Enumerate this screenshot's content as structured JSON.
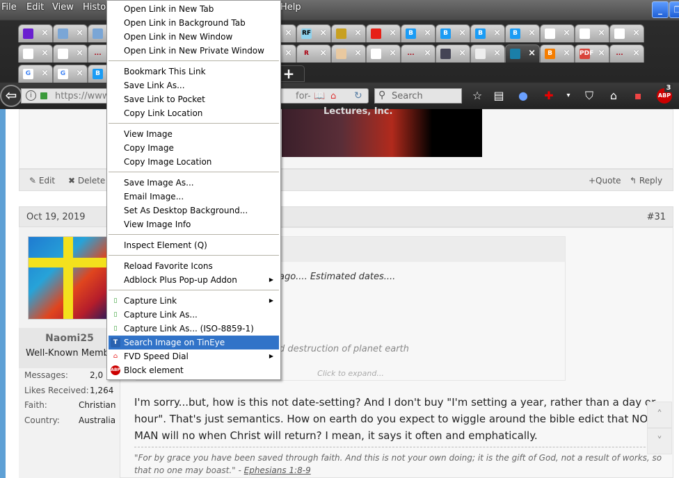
{
  "menubar": {
    "items": [
      "File",
      "Edit",
      "View",
      "Histor",
      "Help"
    ]
  },
  "tabs": {
    "row1": [
      {
        "icon": "mail-icon",
        "color": "#6a1fd0"
      },
      {
        "icon": "bible-icon",
        "color": "#7aa6d6"
      },
      {
        "icon": "bible-icon",
        "color": "#7aa6d6"
      },
      {
        "icon": "tab-icon",
        "color": "#888"
      },
      {
        "icon": "tab-icon",
        "color": "#888"
      },
      {
        "icon": "tab-icon",
        "color": "#888"
      },
      {
        "icon": "tab-icon",
        "color": "#888"
      },
      {
        "icon": "tab-icon",
        "color": "#888"
      },
      {
        "icon": "rf-icon",
        "color": "#8fd3ee",
        "text": "RF"
      },
      {
        "icon": "emblem-icon",
        "color": "#c8a020"
      },
      {
        "icon": "youtube-icon",
        "color": "#e62117"
      },
      {
        "icon": "b-icon",
        "color": "#1a9cf5",
        "text": "B"
      },
      {
        "icon": "b-icon",
        "color": "#1a9cf5",
        "text": "B"
      },
      {
        "icon": "b-icon",
        "color": "#1a9cf5",
        "text": "B"
      },
      {
        "icon": "b-icon",
        "color": "#1a9cf5",
        "text": "B"
      },
      {
        "icon": "sparkle-icon",
        "color": "#fff"
      },
      {
        "icon": "sparkle-icon",
        "color": "#fff"
      },
      {
        "icon": "sparkle-icon",
        "color": "#fff"
      }
    ],
    "row2": [
      {
        "icon": "sparkle-icon",
        "color": "#fff"
      },
      {
        "icon": "sparkle-icon",
        "color": "#fff"
      },
      {
        "icon": "dots-icon",
        "color": "transparent",
        "text": "..."
      },
      {
        "icon": "tab-icon",
        "color": "#888"
      },
      {
        "icon": "tab-icon",
        "color": "#888"
      },
      {
        "icon": "tab-icon",
        "color": "#888"
      },
      {
        "icon": "tab-icon",
        "color": "#888"
      },
      {
        "icon": "tab-icon",
        "color": "#888"
      },
      {
        "icon": "r-icon",
        "color": "transparent",
        "text": "R"
      },
      {
        "icon": "portrait-icon",
        "color": "#e9c9a0"
      },
      {
        "icon": "car-icon",
        "color": "#fff"
      },
      {
        "icon": "dots-icon",
        "color": "transparent",
        "text": "..."
      },
      {
        "icon": "book-icon",
        "color": "#445"
      },
      {
        "icon": "page-icon",
        "color": "#eee"
      },
      {
        "icon": "menorah-icon",
        "color": "#1b7fa8",
        "active": true
      },
      {
        "icon": "blogger-icon",
        "color": "#f57d00",
        "text": "B"
      },
      {
        "icon": "pdf-icon",
        "color": "#d9443a",
        "text": "PDF"
      },
      {
        "icon": "dots-icon",
        "color": "transparent",
        "text": "..."
      }
    ],
    "row3": [
      {
        "icon": "google-icon",
        "color": "#fff",
        "text": "G"
      },
      {
        "icon": "google-icon",
        "color": "#fff",
        "text": "G"
      },
      {
        "icon": "b-icon",
        "color": "#1a9cf5",
        "text": "B"
      }
    ],
    "close": "×",
    "new_tab": "+"
  },
  "navbar": {
    "url_start": "https://www",
    "url_end": "for-",
    "search_placeholder": "Search",
    "abp_badge": "3"
  },
  "context_menu": [
    {
      "label": "Open Link in New Tab"
    },
    {
      "label": "Open Link in Background Tab"
    },
    {
      "label": "Open Link in New Window"
    },
    {
      "label": "Open Link in New Private Window"
    },
    {
      "sep": true
    },
    {
      "label": "Bookmark This Link"
    },
    {
      "label": "Save Link As..."
    },
    {
      "label": "Save Link to Pocket"
    },
    {
      "label": "Copy Link Location"
    },
    {
      "sep": true
    },
    {
      "label": "View Image"
    },
    {
      "label": "Copy Image"
    },
    {
      "label": "Copy Image Location"
    },
    {
      "sep": true
    },
    {
      "label": "Save Image As..."
    },
    {
      "label": "Email Image..."
    },
    {
      "label": "Set As Desktop Background..."
    },
    {
      "label": "View Image Info"
    },
    {
      "sep": true
    },
    {
      "label": "Inspect Element (Q)"
    },
    {
      "sep": true
    },
    {
      "label": "Reload Favorite Icons"
    },
    {
      "label": "Adblock Plus Pop-up Addon",
      "submenu": true
    },
    {
      "sep": true
    },
    {
      "label": "Capture Link",
      "icon": "capture-icon",
      "submenu": true
    },
    {
      "label": "Capture Link As...",
      "icon": "capture-icon"
    },
    {
      "label": "Capture Link As... (ISO-8859-1)",
      "icon": "capture-icon"
    },
    {
      "label": "Search Image on TinEye",
      "icon": "tineye-icon",
      "highlighted": true
    },
    {
      "label": "FVD Speed Dial",
      "icon": "speed-dial-icon",
      "submenu": true
    },
    {
      "label": "Block element",
      "icon": "abp-icon"
    }
  ],
  "post_prev": {
    "image_caption": "Lectures, Inc.",
    "edit": "Edit",
    "delete": "Delete",
    "quote": "+Quote",
    "reply": "Reply"
  },
  "post": {
    "date": "Oct 19, 2019",
    "number": "#31",
    "user": {
      "name": "Naomi25",
      "title": "Well-Known Member",
      "stats": [
        {
          "label": "Messages:",
          "value": "2,0"
        },
        {
          "label": "Likes Received:",
          "value": "1,264"
        },
        {
          "label": "Faith:",
          "value": "Christian"
        },
        {
          "label": "Country:",
          "value": "Australia"
        }
      ]
    },
    "quote": {
      "line1": "ago.... Estimated dates....",
      "line2": "d destruction of planet earth",
      "expand": "Click to expand..."
    },
    "message": "I'm sorry...but, how is this not date-setting? And I don't buy \"I'm setting a year, rather than a day or hour\". That's just semantics. How on earth do you expect to wiggle around the bible edict that NO MAN will no when Christ will return? I mean, it says it often and emphatically.",
    "signature": "\"For by grace you have been saved through faith. And this is not your own doing; it is the gift of God, not a result of works, so that no one may boast.\" - ",
    "signature_link": "Ephesians 1:8-9"
  }
}
